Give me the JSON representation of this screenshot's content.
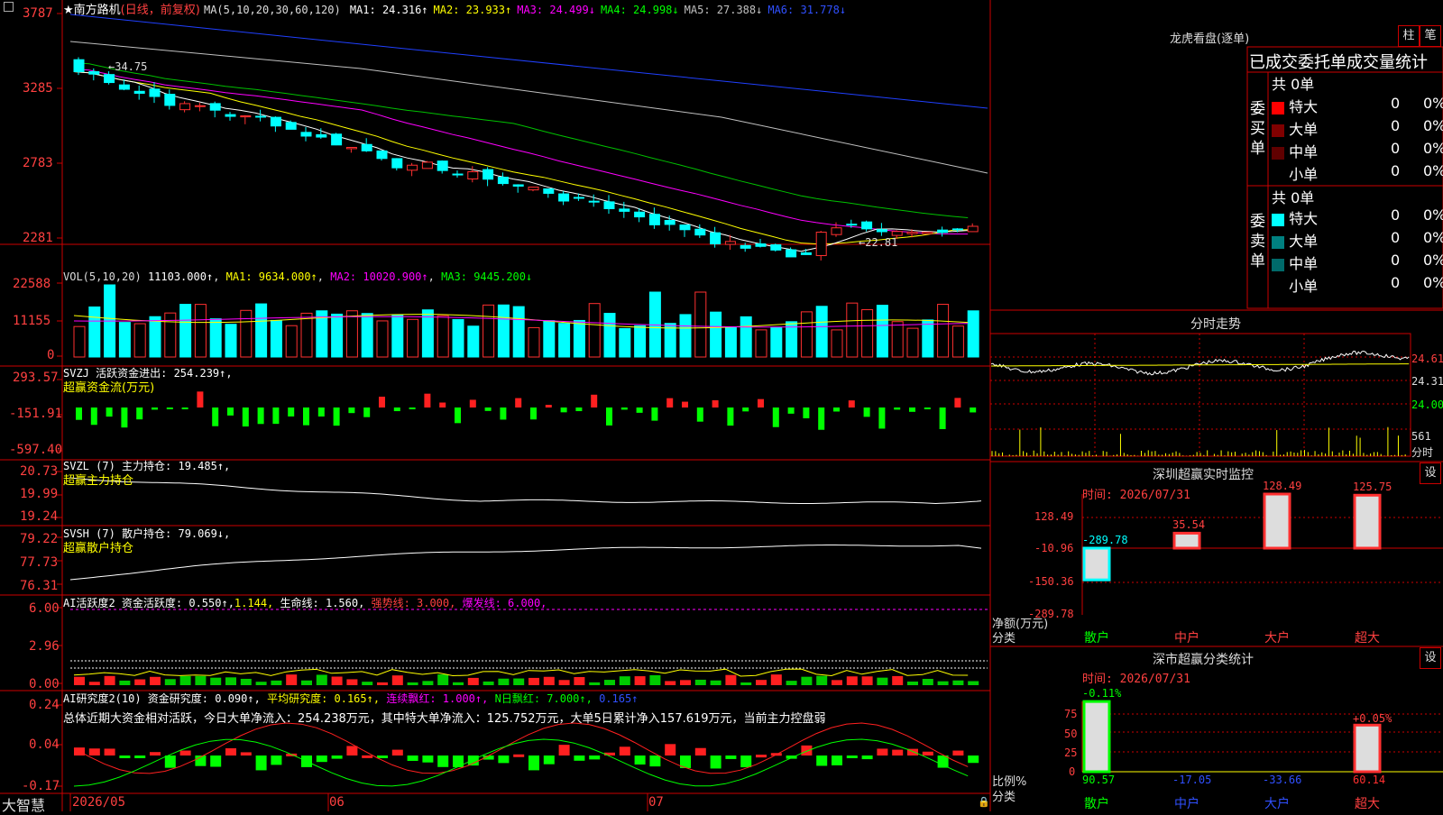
{
  "header": {
    "title_star": "★",
    "stock_name": "南方路机",
    "period": "(日线，前复权)",
    "ma_label": "MA(5,10,20,30,60,120)",
    "ma": [
      {
        "label": "MA1:",
        "value": "24.316↑",
        "color": "#ffffff"
      },
      {
        "label": "MA2:",
        "value": "23.933↑",
        "color": "#ffff00"
      },
      {
        "label": "MA3:",
        "value": "24.499↓",
        "color": "#ff00ff"
      },
      {
        "label": "MA4:",
        "value": "24.998↓",
        "color": "#00ff00"
      },
      {
        "label": "MA5:",
        "value": "27.388↓",
        "color": "#c0c0c0"
      },
      {
        "label": "MA6:",
        "value": "31.778↓",
        "color": "#3050ff"
      }
    ]
  },
  "main_axis": {
    "ticks": [
      "3787",
      "3285",
      "2783",
      "2281"
    ],
    "high_note": "34.75",
    "low_note": "22.81"
  },
  "vol": {
    "title": "VOL(5,10,20)",
    "v": "11103.000↑",
    "ma1": "MA1: 9634.000↑",
    "ma2": "MA2: 10020.900↑",
    "ma3": "MA3: 9445.200↓",
    "ticks": [
      "22588",
      "11155",
      "0"
    ]
  },
  "svzj": {
    "title": "SVZJ  活跃资金进出: 254.239↑,",
    "sub": "超赢资金流(万元)",
    "ticks": [
      "293.57",
      "-151.91",
      "-597.40"
    ]
  },
  "svzl": {
    "title": "SVZL (7) 主力持仓: 19.485↑,",
    "sub": "超赢主力持仓",
    "ticks": [
      "20.73",
      "19.99",
      "19.24"
    ]
  },
  "svsh": {
    "title": "SVSH (7) 散户持仓: 79.069↓,",
    "sub": "超赢散户持仓",
    "ticks": [
      "79.22",
      "77.73",
      "76.31"
    ]
  },
  "ai1": {
    "t1": "AI活跃度2 资金活跃度: 0.550↑,",
    "t2": "1.144,",
    "t3": "生命线: 1.560,",
    "t4": "强势线: 3.000,",
    "t5": "爆发线: 6.000,",
    "ticks": [
      "6.00",
      "2.96",
      "0.00"
    ]
  },
  "ai2": {
    "t1": "AI研究度2(10) 资金研究度: 0.090↑,",
    "t2": "平均研究度: 0.165↑,",
    "t3": "连续飘红: 1.000↑,",
    "t4": "N日飘红: 7.000↑,",
    "t5": "0.165↑",
    "summary": "总体近期大资金相对活跃，今日大单净流入：254.238万元，其中特大单净流入：125.752万元，大单5日累计净入157.619万元，当前主力控盘弱",
    "ticks": [
      "0.24",
      "0.04",
      "-0.17"
    ]
  },
  "bottom": {
    "brand": "大智慧",
    "months": [
      "2026/05",
      "06",
      "07"
    ]
  },
  "longhu": {
    "title": "龙虎看盘(逐单)",
    "btn1": "柱",
    "btn2": "笔",
    "subtitle": "已成交委托单成交量统计",
    "buy_label": "委买单",
    "sell_label": "委卖单",
    "buy_total": "共 0单",
    "sell_total": "共 0单",
    "buy_rows": [
      {
        "name": "特大",
        "count": "0",
        "pct": "0%",
        "color": "#ff0000"
      },
      {
        "name": "大单",
        "count": "0",
        "pct": "0%",
        "color": "#800000"
      },
      {
        "name": "中单",
        "count": "0",
        "pct": "0%",
        "color": "#600000"
      },
      {
        "name": "小单",
        "count": "0",
        "pct": "0%",
        "color": "#000000"
      }
    ],
    "sell_rows": [
      {
        "name": "特大",
        "count": "0",
        "pct": "0%",
        "color": "#00ffff"
      },
      {
        "name": "大单",
        "count": "0",
        "pct": "0%",
        "color": "#008080"
      },
      {
        "name": "中单",
        "count": "0",
        "pct": "0%",
        "color": "#006a6a"
      },
      {
        "name": "小单",
        "count": "0",
        "pct": "0%",
        "color": "#000000"
      }
    ]
  },
  "intraday": {
    "title": "分时走势",
    "ticks": [
      "24.61",
      "24.31",
      "24.00"
    ],
    "vol_tick": "561",
    "vol_label": "分时"
  },
  "monitor": {
    "title": "深圳超赢实时监控",
    "btn": "设",
    "time": "时间: 2026/07/31",
    "ticks": [
      "128.49",
      "-10.96",
      "-150.36",
      "-289.78"
    ],
    "ylabel1": "净额(万元)",
    "ylabel2": "分类",
    "bars": [
      {
        "name": "散户",
        "value": -289.78,
        "label": "-289.78",
        "color": "#00ffff"
      },
      {
        "name": "中户",
        "value": 35.54,
        "label": "35.54",
        "color": "#ff3030"
      },
      {
        "name": "大户",
        "value": 128.49,
        "label": "128.49",
        "color": "#ff3030"
      },
      {
        "name": "超大",
        "value": 125.75,
        "label": "125.75",
        "color": "#ff3030"
      }
    ]
  },
  "classify": {
    "title": "深市超赢分类统计",
    "btn": "设",
    "time": "时间: 2026/07/31",
    "ticks": [
      "75",
      "50",
      "25",
      "0"
    ],
    "ylabel1": "比例%",
    "ylabel2": "分类",
    "top_labels": [
      "-0.11%",
      "+0.05%"
    ],
    "bars": [
      {
        "name": "散户",
        "value": 90.57,
        "label": "90.57",
        "color": "#00ff00"
      },
      {
        "name": "中户",
        "value": -17.05,
        "label": "-17.05",
        "color": "#3050ff"
      },
      {
        "name": "大户",
        "value": -33.66,
        "label": "-33.66",
        "color": "#3050ff"
      },
      {
        "name": "超大",
        "value": 60.14,
        "label": "60.14",
        "color": "#ff3030"
      }
    ]
  }
}
